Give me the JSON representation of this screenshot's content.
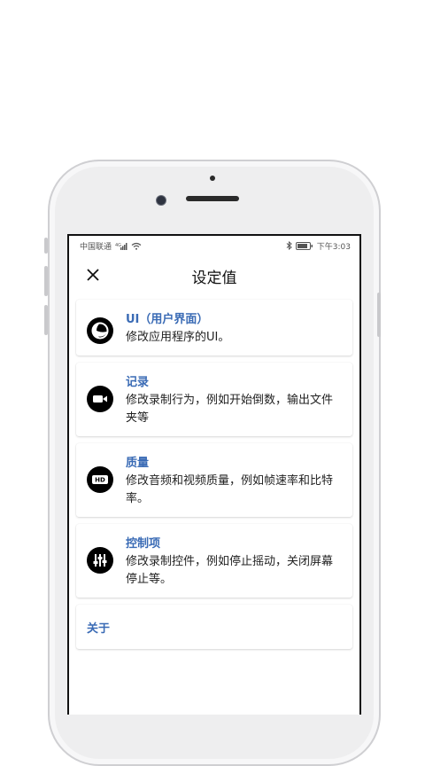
{
  "status_bar": {
    "carrier": "中国联通",
    "time": "下午3:03"
  },
  "header": {
    "title": "设定值",
    "close_icon": "close-icon"
  },
  "settings": [
    {
      "icon": "theme-icon",
      "title": "UI（用户界面）",
      "desc": "修改应用程序的UI。"
    },
    {
      "icon": "video-camera-icon",
      "title": "记录",
      "desc": "修改录制行为，例如开始倒数，输出文件夹等"
    },
    {
      "icon": "hd-icon",
      "title": "质量",
      "desc": "修改音频和视频质量，例如帧速率和比特率。"
    },
    {
      "icon": "equalizer-icon",
      "title": "控制项",
      "desc": "修改录制控件，例如停止摇动，关闭屏幕停止等。"
    }
  ],
  "about": {
    "label": "关于"
  },
  "colors": {
    "accent": "#3a6bb5",
    "text": "#222222"
  }
}
